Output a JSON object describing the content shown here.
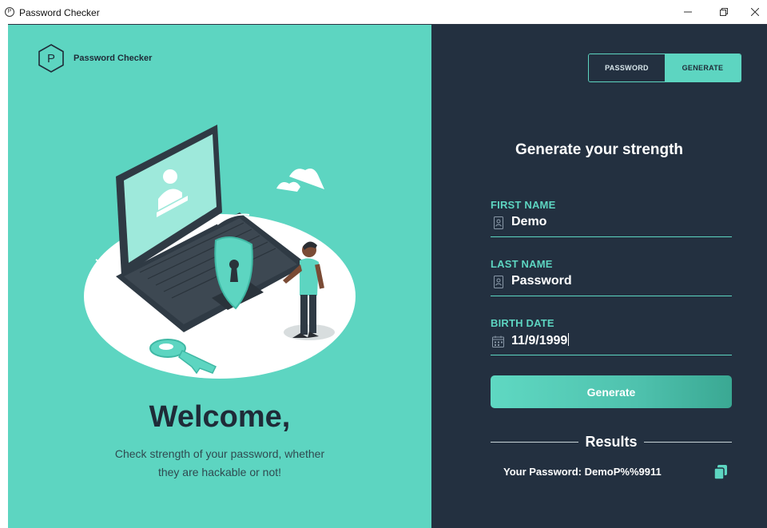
{
  "window": {
    "title": "Password Checker",
    "app_icon_letter": "P",
    "controls": [
      "minimize-icon",
      "maximize-icon",
      "close-icon"
    ]
  },
  "brand": {
    "logo_letter": "P",
    "name": "Password Checker"
  },
  "welcome": {
    "heading": "Welcome,",
    "subtitle_line1": "Check strength of your password, whether",
    "subtitle_line2": "they are hackable or not!"
  },
  "mode_toggle": {
    "password_label": "PASSWORD",
    "generate_label": "GENERATE",
    "selected": "GENERATE"
  },
  "form": {
    "title": "Generate your strength",
    "first_name": {
      "label": "FIRST NAME",
      "value": "Demo",
      "icon": "id-card-icon"
    },
    "last_name": {
      "label": "LAST NAME",
      "value": "Password",
      "icon": "id-card-icon"
    },
    "birth_date": {
      "label": "BIRTH DATE",
      "value": "11/9/1999",
      "icon": "calendar-icon"
    },
    "generate_label": "Generate"
  },
  "results": {
    "title": "Results",
    "password_text": "Your Password: DemoP%%9911",
    "copy_icon": "copy-icon"
  },
  "colors": {
    "accent": "#5dd5c1",
    "dark_panel": "#233040",
    "text_dark": "#1f2b38"
  }
}
